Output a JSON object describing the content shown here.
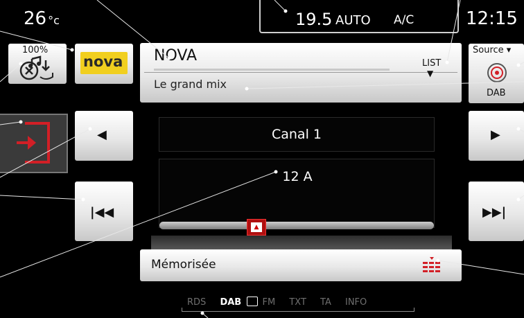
{
  "status_bar": {
    "outside_temp": "26",
    "outside_temp_unit": "°c",
    "climate_temp": "19.5",
    "climate_mode": "AUTO",
    "climate_ac": "A/C",
    "clock": "12:15"
  },
  "volume": {
    "percent_label": "100%"
  },
  "station": {
    "logo_text": "nova",
    "name": "NOVA",
    "subtitle": "Le grand mix",
    "list_label": "LIST"
  },
  "source": {
    "label": "Source",
    "value": "DAB"
  },
  "tuner": {
    "channel": "Canal 1",
    "band": "12 A"
  },
  "memory": {
    "label": "Mémorisée"
  },
  "bottom_tabs": {
    "rds": "RDS",
    "dab": "DAB",
    "fm": "FM",
    "txt": "TXT",
    "ta": "TA",
    "info": "INFO"
  },
  "colors": {
    "accent_red": "#d21f26",
    "logo_yellow": "#f1cf1f",
    "background": "#000000"
  }
}
